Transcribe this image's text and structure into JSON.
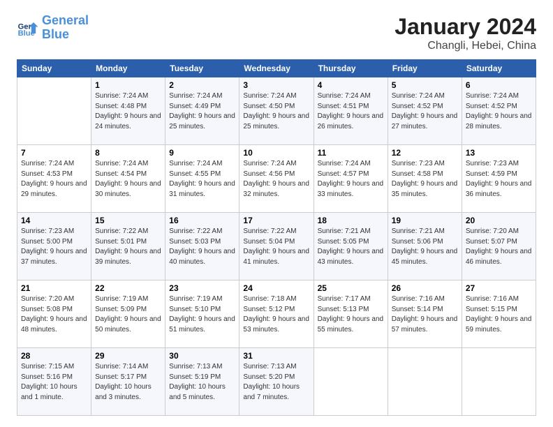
{
  "header": {
    "logo_line1": "General",
    "logo_line2": "Blue",
    "month_title": "January 2024",
    "location": "Changli, Hebei, China"
  },
  "weekdays": [
    "Sunday",
    "Monday",
    "Tuesday",
    "Wednesday",
    "Thursday",
    "Friday",
    "Saturday"
  ],
  "weeks": [
    [
      {
        "day": null
      },
      {
        "day": 1,
        "sunrise": "7:24 AM",
        "sunset": "4:48 PM",
        "daylight": "9 hours and 24 minutes."
      },
      {
        "day": 2,
        "sunrise": "7:24 AM",
        "sunset": "4:49 PM",
        "daylight": "9 hours and 25 minutes."
      },
      {
        "day": 3,
        "sunrise": "7:24 AM",
        "sunset": "4:50 PM",
        "daylight": "9 hours and 25 minutes."
      },
      {
        "day": 4,
        "sunrise": "7:24 AM",
        "sunset": "4:51 PM",
        "daylight": "9 hours and 26 minutes."
      },
      {
        "day": 5,
        "sunrise": "7:24 AM",
        "sunset": "4:52 PM",
        "daylight": "9 hours and 27 minutes."
      },
      {
        "day": 6,
        "sunrise": "7:24 AM",
        "sunset": "4:52 PM",
        "daylight": "9 hours and 28 minutes."
      }
    ],
    [
      {
        "day": 7,
        "sunrise": "7:24 AM",
        "sunset": "4:53 PM",
        "daylight": "9 hours and 29 minutes."
      },
      {
        "day": 8,
        "sunrise": "7:24 AM",
        "sunset": "4:54 PM",
        "daylight": "9 hours and 30 minutes."
      },
      {
        "day": 9,
        "sunrise": "7:24 AM",
        "sunset": "4:55 PM",
        "daylight": "9 hours and 31 minutes."
      },
      {
        "day": 10,
        "sunrise": "7:24 AM",
        "sunset": "4:56 PM",
        "daylight": "9 hours and 32 minutes."
      },
      {
        "day": 11,
        "sunrise": "7:24 AM",
        "sunset": "4:57 PM",
        "daylight": "9 hours and 33 minutes."
      },
      {
        "day": 12,
        "sunrise": "7:23 AM",
        "sunset": "4:58 PM",
        "daylight": "9 hours and 35 minutes."
      },
      {
        "day": 13,
        "sunrise": "7:23 AM",
        "sunset": "4:59 PM",
        "daylight": "9 hours and 36 minutes."
      }
    ],
    [
      {
        "day": 14,
        "sunrise": "7:23 AM",
        "sunset": "5:00 PM",
        "daylight": "9 hours and 37 minutes."
      },
      {
        "day": 15,
        "sunrise": "7:22 AM",
        "sunset": "5:01 PM",
        "daylight": "9 hours and 39 minutes."
      },
      {
        "day": 16,
        "sunrise": "7:22 AM",
        "sunset": "5:03 PM",
        "daylight": "9 hours and 40 minutes."
      },
      {
        "day": 17,
        "sunrise": "7:22 AM",
        "sunset": "5:04 PM",
        "daylight": "9 hours and 41 minutes."
      },
      {
        "day": 18,
        "sunrise": "7:21 AM",
        "sunset": "5:05 PM",
        "daylight": "9 hours and 43 minutes."
      },
      {
        "day": 19,
        "sunrise": "7:21 AM",
        "sunset": "5:06 PM",
        "daylight": "9 hours and 45 minutes."
      },
      {
        "day": 20,
        "sunrise": "7:20 AM",
        "sunset": "5:07 PM",
        "daylight": "9 hours and 46 minutes."
      }
    ],
    [
      {
        "day": 21,
        "sunrise": "7:20 AM",
        "sunset": "5:08 PM",
        "daylight": "9 hours and 48 minutes."
      },
      {
        "day": 22,
        "sunrise": "7:19 AM",
        "sunset": "5:09 PM",
        "daylight": "9 hours and 50 minutes."
      },
      {
        "day": 23,
        "sunrise": "7:19 AM",
        "sunset": "5:10 PM",
        "daylight": "9 hours and 51 minutes."
      },
      {
        "day": 24,
        "sunrise": "7:18 AM",
        "sunset": "5:12 PM",
        "daylight": "9 hours and 53 minutes."
      },
      {
        "day": 25,
        "sunrise": "7:17 AM",
        "sunset": "5:13 PM",
        "daylight": "9 hours and 55 minutes."
      },
      {
        "day": 26,
        "sunrise": "7:16 AM",
        "sunset": "5:14 PM",
        "daylight": "9 hours and 57 minutes."
      },
      {
        "day": 27,
        "sunrise": "7:16 AM",
        "sunset": "5:15 PM",
        "daylight": "9 hours and 59 minutes."
      }
    ],
    [
      {
        "day": 28,
        "sunrise": "7:15 AM",
        "sunset": "5:16 PM",
        "daylight": "10 hours and 1 minute."
      },
      {
        "day": 29,
        "sunrise": "7:14 AM",
        "sunset": "5:17 PM",
        "daylight": "10 hours and 3 minutes."
      },
      {
        "day": 30,
        "sunrise": "7:13 AM",
        "sunset": "5:19 PM",
        "daylight": "10 hours and 5 minutes."
      },
      {
        "day": 31,
        "sunrise": "7:13 AM",
        "sunset": "5:20 PM",
        "daylight": "10 hours and 7 minutes."
      },
      {
        "day": null
      },
      {
        "day": null
      },
      {
        "day": null
      }
    ]
  ]
}
